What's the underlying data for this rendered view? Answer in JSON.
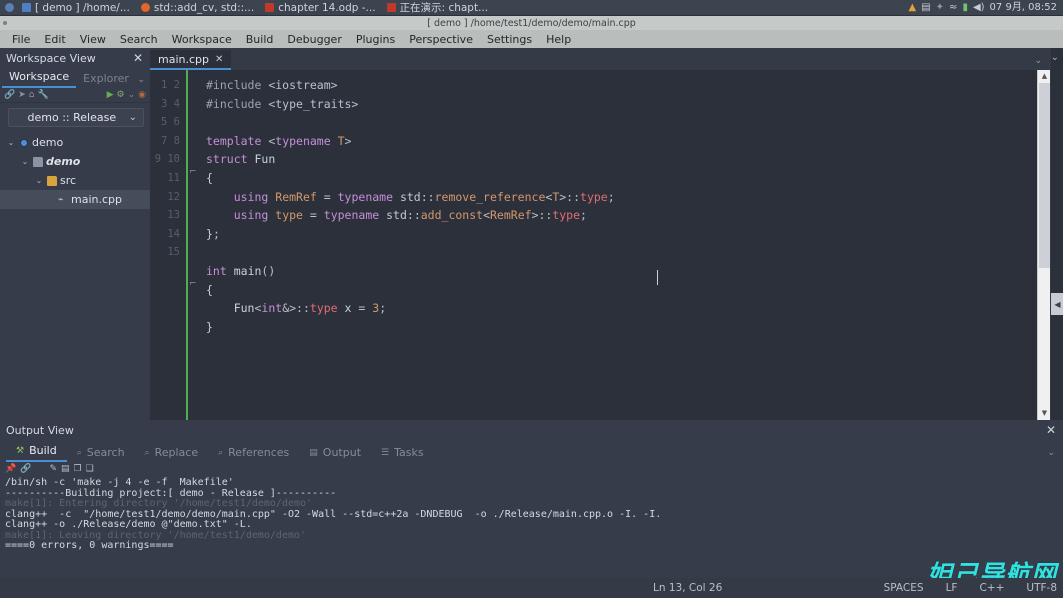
{
  "taskbar": {
    "show_desktop_icon": "butterfly-icon",
    "tasks": [
      {
        "label": "[ demo ] /home/...",
        "icon": "app-window-icon",
        "active": true
      },
      {
        "label": "std::add_cv, std::...",
        "icon": "firefox-icon",
        "active": false
      },
      {
        "label": "chapter 14.odp -...",
        "icon": "impress-icon",
        "active": false
      },
      {
        "label": "正在演示: chapt...",
        "icon": "impress-icon",
        "active": false
      }
    ],
    "window_title": "[ demo ] /home/test1/demo/demo/main.cpp",
    "tray": {
      "icons": [
        "warning-icon",
        "keyboard-icon",
        "bluetooth-icon",
        "wifi-icon",
        "battery-icon",
        "volume-icon"
      ],
      "clock": "07 9月, 08:52"
    }
  },
  "titlebar": {
    "title": "[ demo ] /home/test1/demo/demo/main.cpp"
  },
  "menubar": {
    "items": [
      "File",
      "Edit",
      "View",
      "Search",
      "Workspace",
      "Build",
      "Debugger",
      "Plugins",
      "Perspective",
      "Settings",
      "Help"
    ]
  },
  "workspace_panel": {
    "title": "Workspace View",
    "close_label": "✕",
    "tabs": [
      {
        "label": "Workspace",
        "active": true
      },
      {
        "label": "Explorer",
        "active": false
      }
    ],
    "tab_chevron": "⌄",
    "toolbar_icons": [
      "link-icon",
      "send-icon",
      "home-icon",
      "wrench-icon",
      "run-icon",
      "build-icon",
      "chevron-down-icon",
      "stop-icon"
    ],
    "project_selector": {
      "value": "demo :: Release",
      "chevron": "⌄"
    },
    "tree": [
      {
        "depth": 0,
        "arrow": "⌄",
        "icon": "workspace-disc-icon",
        "label": "demo",
        "italic": false,
        "selected": false
      },
      {
        "depth": 1,
        "arrow": "⌄",
        "icon": "folder-icon",
        "label": "demo",
        "italic": true,
        "selected": false
      },
      {
        "depth": 2,
        "arrow": "⌄",
        "icon": "folder-yellow-icon",
        "label": "src",
        "italic": false,
        "selected": false
      },
      {
        "depth": 3,
        "arrow": "",
        "icon": "cpp-file-icon",
        "label": "main.cpp",
        "italic": false,
        "selected": true
      }
    ]
  },
  "editor": {
    "tab": {
      "label": "main.cpp",
      "close": "✕"
    },
    "tab_chevron": "⌄",
    "line_numbers": [
      "1",
      "2",
      "3",
      "4",
      "5",
      "6",
      "7",
      "8",
      "9",
      "10",
      "11",
      "12",
      "13",
      "14",
      "15"
    ],
    "fold_rows": [
      6,
      12
    ],
    "fold_glyph": "⊟",
    "code_lines": [
      "#include <iostream>",
      "#include <type_traits>",
      "",
      "template <typename T>",
      "struct Fun",
      "{",
      "    using RemRef = typename std::remove_reference<T>::type;",
      "    using type = typename std::add_const<RemRef>::type;",
      "};",
      "",
      "int main()",
      "{",
      "    Fun<int&>::type x = 3;",
      "}",
      ""
    ],
    "scrollbar": {
      "up_arrow": "▲",
      "down_arrow": "▼"
    },
    "collapse_chevron": "◀"
  },
  "output_panel": {
    "title": "Output View",
    "close_label": "✕",
    "tabs": [
      {
        "label": "Build",
        "icon": "build-icon",
        "active": true
      },
      {
        "label": "Search",
        "icon": "search-icon",
        "active": false
      },
      {
        "label": "Replace",
        "icon": "replace-icon",
        "active": false
      },
      {
        "label": "References",
        "icon": "references-icon",
        "active": false
      },
      {
        "label": "Output",
        "icon": "output-icon",
        "active": false
      },
      {
        "label": "Tasks",
        "icon": "tasks-icon",
        "active": false
      }
    ],
    "tab_chevron": "⌄",
    "toolbar_icons": [
      "pin-icon",
      "link-icon",
      "clear-icon",
      "save-icon",
      "copy-icon",
      "copyall-icon"
    ],
    "log": [
      {
        "text": "/bin/sh -c 'make -j 4 -e -f  Makefile'",
        "dim": false
      },
      {
        "text": "----------Building project:[ demo - Release ]----------",
        "dim": false
      },
      {
        "text": "make[1]: Entering directory '/home/test1/demo/demo'",
        "dim": true
      },
      {
        "text": "clang++  -c  \"/home/test1/demo/demo/main.cpp\" -O2 -Wall --std=c++2a -DNDEBUG  -o ./Release/main.cpp.o -I. -I.",
        "dim": false
      },
      {
        "text": "clang++ -o ./Release/demo @\"demo.txt\" -L.",
        "dim": false
      },
      {
        "text": "make[1]: Leaving directory '/home/test1/demo/demo'",
        "dim": true
      },
      {
        "text": "====0 errors, 0 warnings====",
        "dim": false
      }
    ]
  },
  "statusbar": {
    "line_col": "Ln 13, Col 26",
    "indent": "SPACES",
    "eol": "LF",
    "language": "C++",
    "encoding": "UTF-8"
  },
  "watermark": {
    "text": "妲己导航网",
    "color": "#2fe3e0"
  }
}
